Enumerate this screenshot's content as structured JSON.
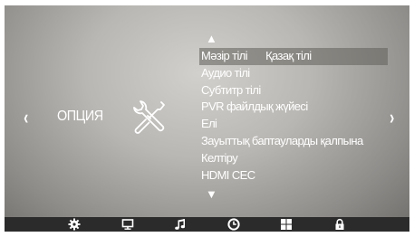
{
  "navigation": {
    "left_arrow": "‹",
    "right_arrow": "›",
    "up_arrow": "▲",
    "down_arrow": "▼"
  },
  "category": {
    "title": "ОПЦИЯ",
    "icon": "tools-icon"
  },
  "menu": {
    "items": [
      {
        "label": "Мәзір тілі",
        "value": "Қазақ тілі",
        "selected": true
      },
      {
        "label": "Аудио тілі"
      },
      {
        "label": "Субтитр тілі"
      },
      {
        "label": "PVR файлдық жүйесі"
      },
      {
        "label": "Елі"
      },
      {
        "label": "Зауыттық баптауларды қалпына"
      },
      {
        "label": "Келтіру"
      },
      {
        "label": "HDMI CEC"
      }
    ]
  },
  "bottom_bar": {
    "icons": [
      "gear-icon",
      "monitor-icon",
      "music-note-icon",
      "clock-icon",
      "grid-icon",
      "lock-icon"
    ]
  },
  "colors": {
    "text": "#ffffff",
    "bottom_bar": "#2b2b2b",
    "selection": "#605e5a"
  }
}
